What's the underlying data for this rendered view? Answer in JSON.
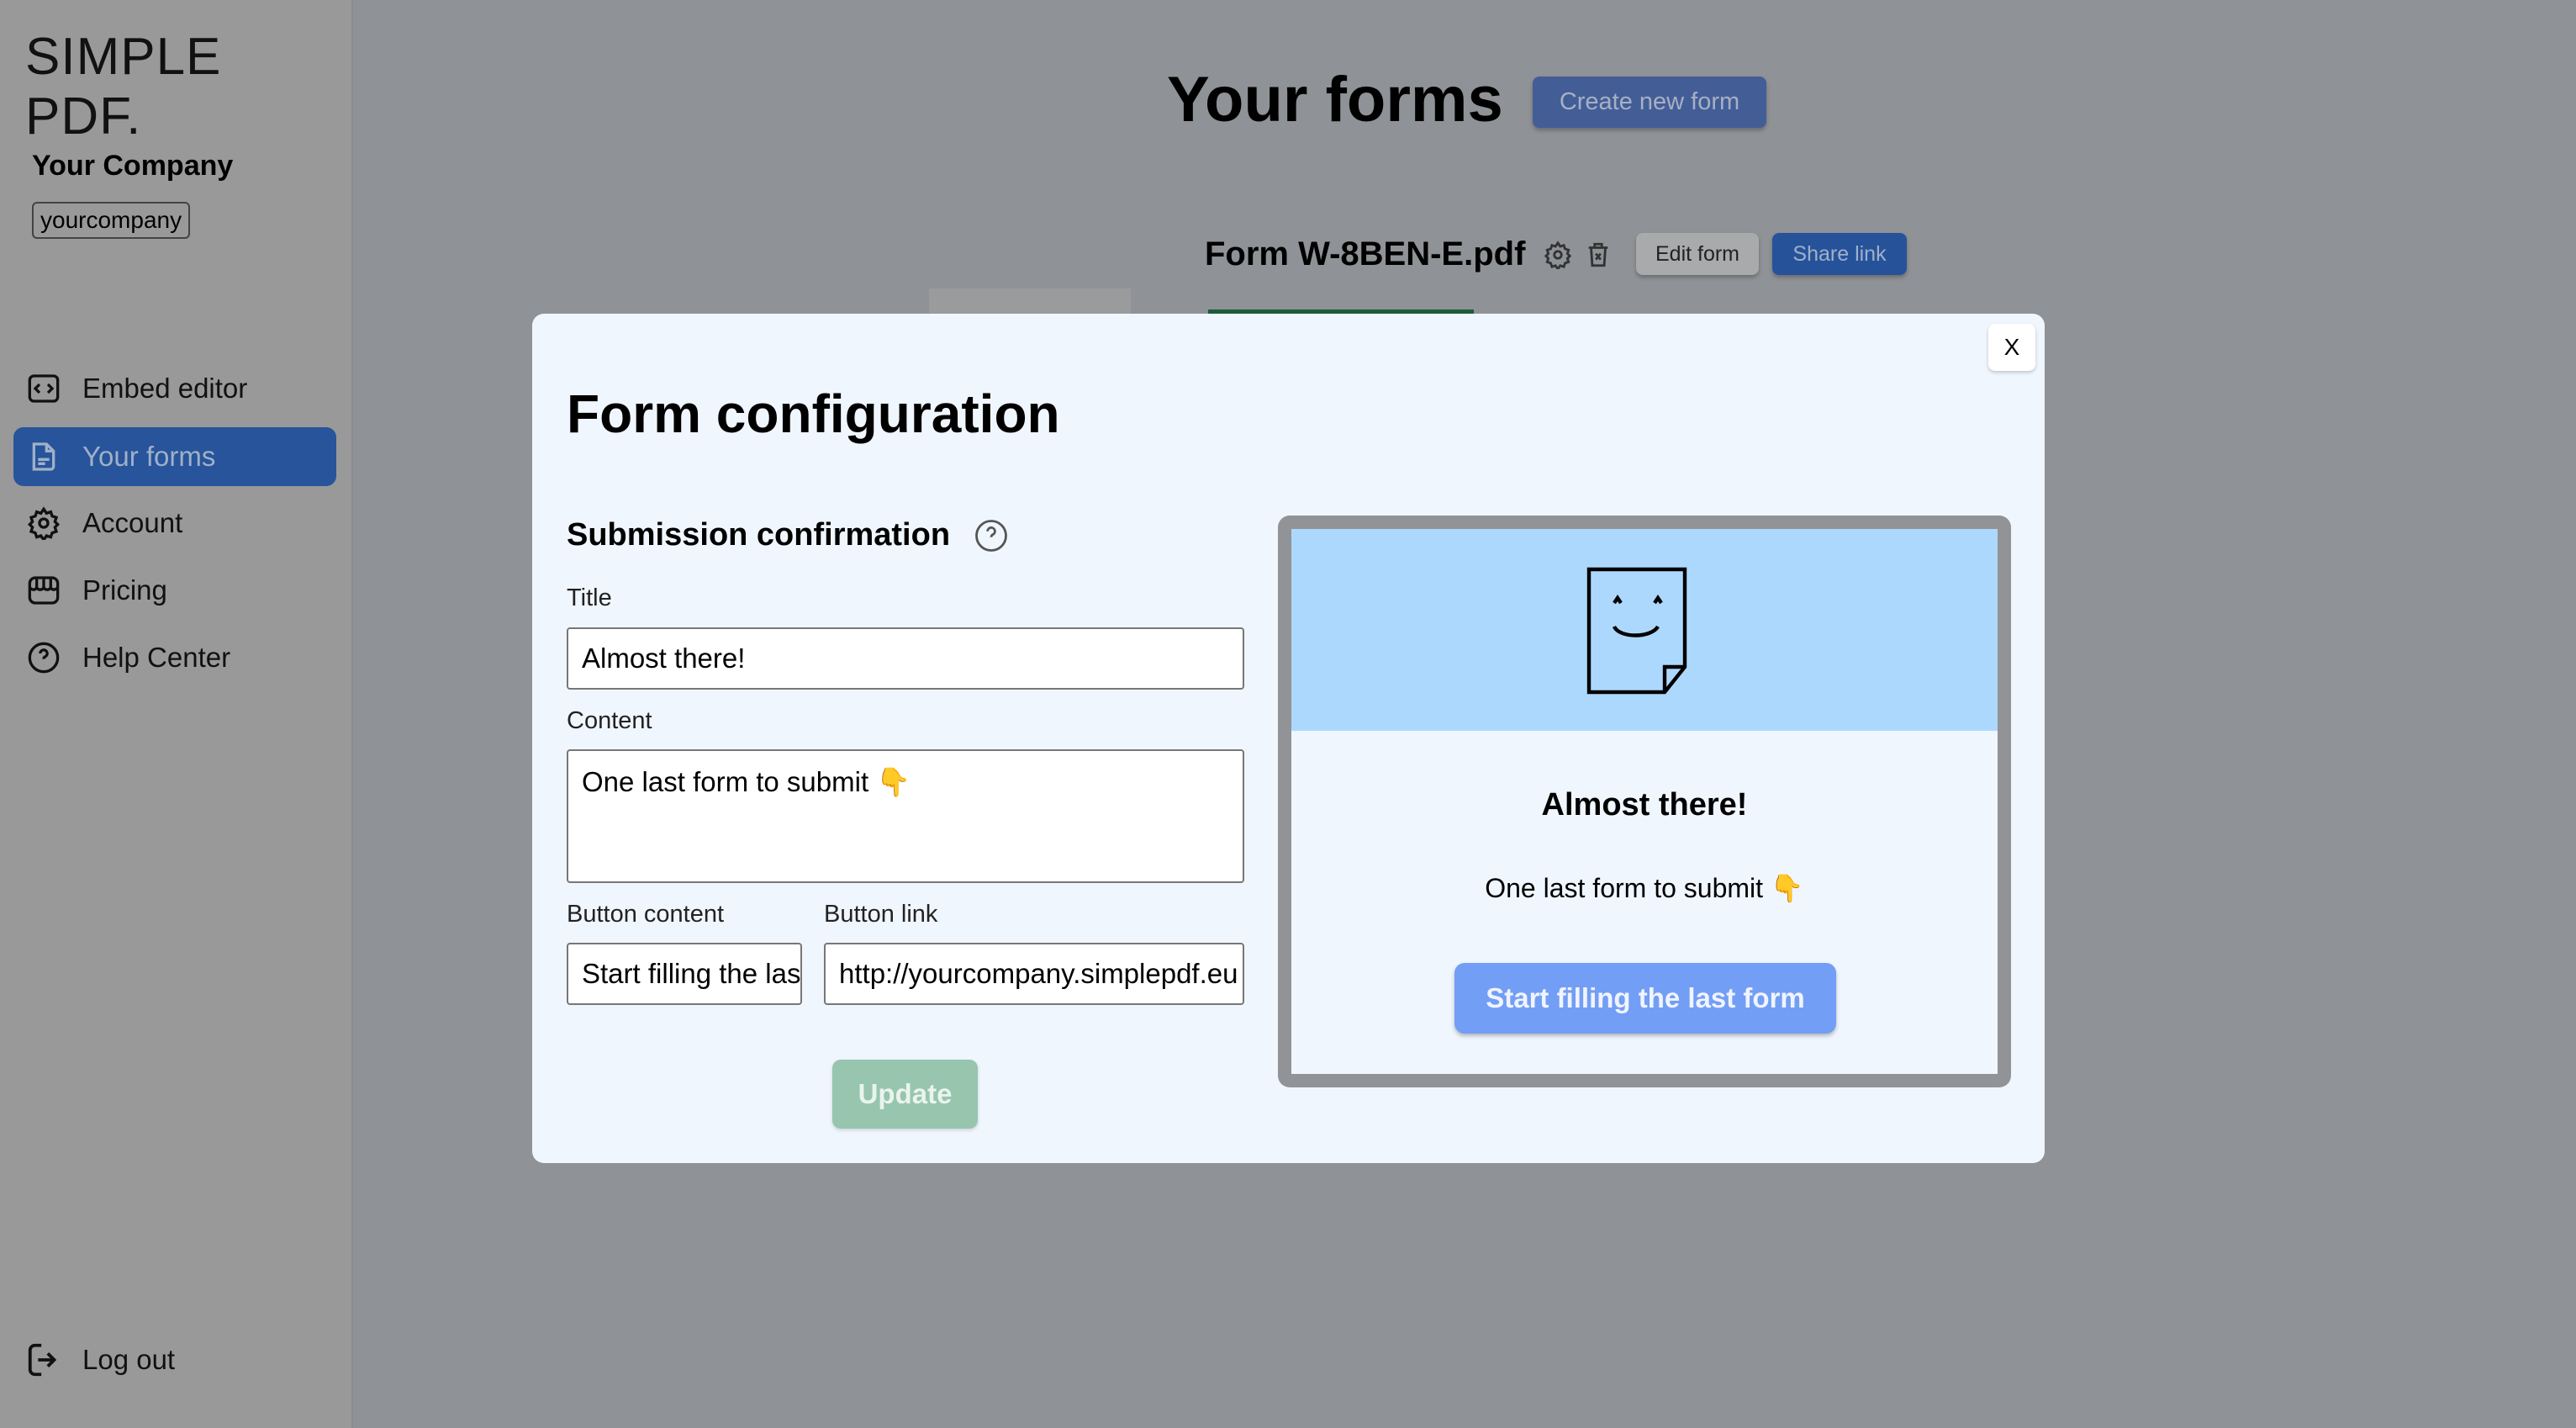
{
  "sidebar": {
    "logo": "SIMPLE PDF.",
    "company_name": "Your Company",
    "company_slug": "yourcompany",
    "items": [
      {
        "label": "Embed editor",
        "icon": "code-icon"
      },
      {
        "label": "Your forms",
        "icon": "document-icon",
        "active": true
      },
      {
        "label": "Account",
        "icon": "gear-icon"
      },
      {
        "label": "Pricing",
        "icon": "store-icon"
      },
      {
        "label": "Help Center",
        "icon": "help-icon"
      }
    ],
    "logout": "Log out"
  },
  "main": {
    "title": "Your forms",
    "create_button": "Create new form",
    "form": {
      "name": "Form W-8BEN-E.pdf",
      "edit_button": "Edit form",
      "share_button": "Share link"
    }
  },
  "modal": {
    "title": "Form configuration",
    "close": "X",
    "section": "Submission confirmation",
    "fields": {
      "title_label": "Title",
      "title_value": "Almost there!",
      "content_label": "Content",
      "content_value": "One last form to submit 👇",
      "button_content_label": "Button content",
      "button_content_value": "Start filling the last form",
      "button_link_label": "Button link",
      "button_link_value": "http://yourcompany.simplepdf.eu"
    },
    "update_button": "Update",
    "preview": {
      "title": "Almost there!",
      "text": "One last form to submit 👇",
      "button": "Start filling the last form"
    }
  },
  "colors": {
    "accent": "#27549a",
    "update": "#97c5ae",
    "preview_header": "#add8fe",
    "preview_button": "#739ef5"
  }
}
